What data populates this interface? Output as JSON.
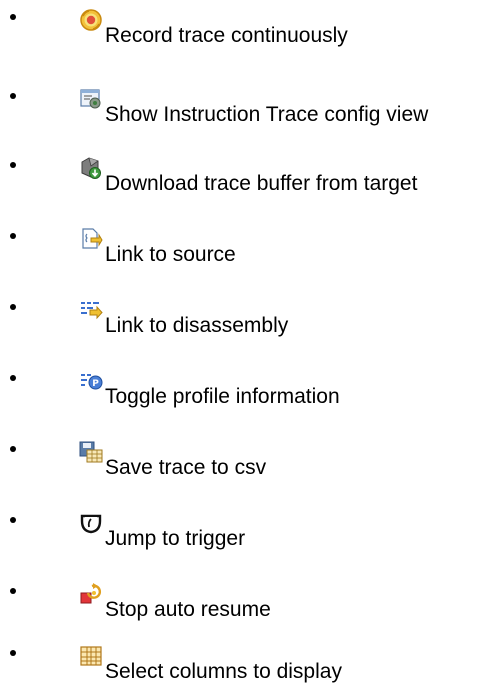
{
  "items": [
    {
      "label": "Record trace continuously",
      "icon": "record-trace-icon"
    },
    {
      "label": "Show Instruction Trace config view",
      "icon": "trace-config-view-icon"
    },
    {
      "label": "Download trace buffer from target",
      "icon": "download-trace-buffer-icon"
    },
    {
      "label": "Link to source",
      "icon": "link-to-source-icon"
    },
    {
      "label": "Link to disassembly",
      "icon": "link-to-disassembly-icon"
    },
    {
      "label": "Toggle profile information",
      "icon": "toggle-profile-icon"
    },
    {
      "label": "Save trace to csv",
      "icon": "save-csv-icon"
    },
    {
      "label": "Jump to trigger",
      "icon": "jump-to-trigger-icon"
    },
    {
      "label": "Stop auto resume",
      "icon": "stop-auto-resume-icon"
    },
    {
      "label": "Select columns to display",
      "icon": "select-columns-icon"
    }
  ]
}
